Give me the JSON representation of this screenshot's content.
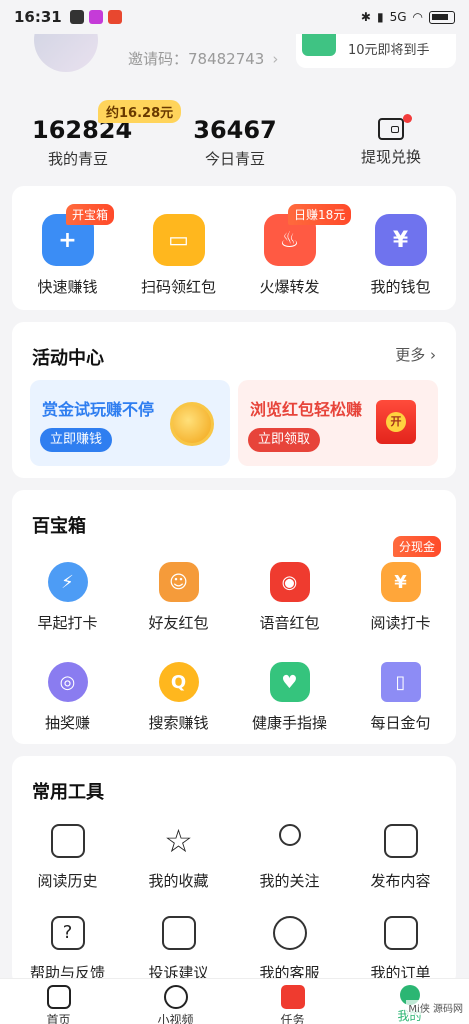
{
  "status_bar": {
    "time": "16:31",
    "network": "5G"
  },
  "profile": {
    "invite_label": "邀请码：78482743",
    "promo_text": "10元即将到手"
  },
  "stats": {
    "my_beans_value": "162824",
    "my_beans_label": "我的青豆",
    "approx_amount": "约16.28元",
    "today_beans_value": "36467",
    "today_beans_label": "今日青豆",
    "withdraw_label": "提现兑换"
  },
  "quick": {
    "items": [
      {
        "label": "快速赚钱",
        "badge": "开宝箱",
        "color": "#3b8df5"
      },
      {
        "label": "扫码领红包",
        "badge": "",
        "color": "#ffb71e"
      },
      {
        "label": "火爆转发",
        "badge": "日赚18元",
        "color": "#ff5a43"
      },
      {
        "label": "我的钱包",
        "badge": "",
        "color": "#6f73ee"
      }
    ]
  },
  "activity": {
    "title": "活动中心",
    "more": "更多",
    "cards": [
      {
        "title": "赏金试玩赚不停",
        "button": "立即赚钱",
        "title_color": "#2f7ef0",
        "button_color": "#2f7ef0",
        "bg": "#eaf3ff"
      },
      {
        "title": "浏览红包轻松赚",
        "button": "立即领取",
        "title_color": "#e7443a",
        "button_color": "#e7443a",
        "bg": "#fff0ee"
      }
    ]
  },
  "treasure": {
    "title": "百宝箱",
    "row1": [
      {
        "label": "早起打卡",
        "badge": "",
        "color": "#4d9cf5"
      },
      {
        "label": "好友红包",
        "badge": "",
        "color": "#f59b3a"
      },
      {
        "label": "语音红包",
        "badge": "",
        "color": "#ef3b2f"
      },
      {
        "label": "阅读打卡",
        "badge": "分现金",
        "color": "#ffa63a"
      }
    ],
    "row2": [
      {
        "label": "抽奖赚",
        "badge": "",
        "color": "#8a7cf0"
      },
      {
        "label": "搜索赚钱",
        "badge": "",
        "color": "#ffb71e"
      },
      {
        "label": "健康手指操",
        "badge": "",
        "color": "#35c47d"
      },
      {
        "label": "每日金句",
        "badge": "",
        "color": "#8d8cf5"
      }
    ]
  },
  "tools": {
    "title": "常用工具",
    "row1": [
      {
        "label": "阅读历史",
        "icon": "history-icon"
      },
      {
        "label": "我的收藏",
        "icon": "star-icon"
      },
      {
        "label": "我的关注",
        "icon": "follow-icon"
      },
      {
        "label": "发布内容",
        "icon": "edit-icon"
      }
    ],
    "row2": [
      {
        "label": "帮助与反馈",
        "icon": "help-icon"
      },
      {
        "label": "投诉建议",
        "icon": "mail-icon"
      },
      {
        "label": "我的客服",
        "icon": "headset-icon"
      },
      {
        "label": "我的订单",
        "icon": "clipboard-icon"
      }
    ]
  },
  "tabbar": {
    "items": [
      {
        "label": "首页"
      },
      {
        "label": "小视频"
      },
      {
        "label": "任务"
      },
      {
        "label": "我的"
      }
    ]
  },
  "watermark": "Mi侠 源码网"
}
